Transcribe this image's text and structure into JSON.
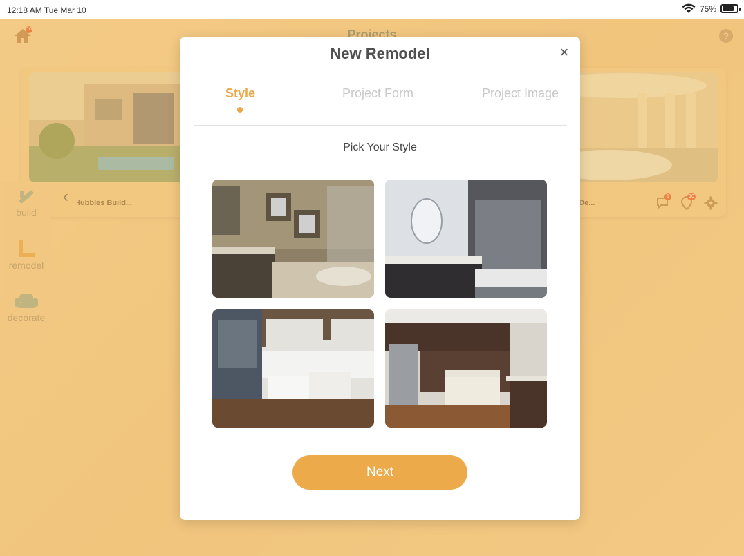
{
  "status_bar": {
    "time": "12:18 AM  Tue Mar 10",
    "battery": "75%"
  },
  "app": {
    "title": "Projects",
    "home_badge": "10",
    "help_label": "?",
    "cards": [
      {
        "caption": "Hubbles Build..."
      },
      {
        "caption": "s De..."
      }
    ],
    "card_badges": {
      "chat": "1",
      "pin": "10"
    },
    "sidebar": {
      "items": [
        {
          "label": "build"
        },
        {
          "label": "remodel"
        },
        {
          "label": "decorate"
        }
      ]
    },
    "collapse_label": "‹"
  },
  "modal": {
    "title": "New Remodel",
    "close_label": "×",
    "tabs": [
      {
        "label": "Style",
        "active": true
      },
      {
        "label": "Project Form",
        "active": false
      },
      {
        "label": "Project Image",
        "active": false
      }
    ],
    "subtitle": "Pick Your Style",
    "next_label": "Next"
  },
  "colors": {
    "accent": "#ECAA4B",
    "background": "#F4CF8E"
  }
}
